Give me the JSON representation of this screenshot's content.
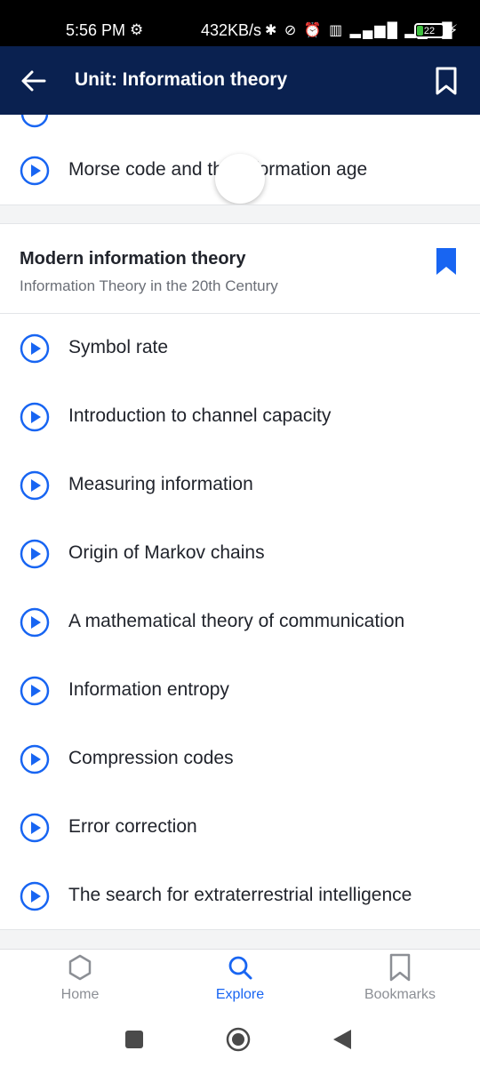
{
  "status_bar": {
    "time": "5:56 PM",
    "settings_glyph": "⚙",
    "network_speed": "432KB/s",
    "icons_text": "✱ ⊘ ⏰ ▥ ▂▄▆█ ▂▄▆█",
    "battery": "22",
    "battery_fraction": 0.22
  },
  "app_bar": {
    "title": "Unit: Information theory",
    "back_icon": "arrow-left-icon",
    "bookmark_icon": "bookmark-outline-icon"
  },
  "colors": {
    "app_bar_bg": "#0a2150",
    "accent": "#1865f2",
    "text": "#21242c",
    "muted": "#6b6f77"
  },
  "previous_section": {
    "last_lesson": "Morse code and the information age"
  },
  "section": {
    "title": "Modern information theory",
    "subtitle": "Information Theory in the 20th Century",
    "bookmarked": true,
    "lessons": [
      "Symbol rate",
      "Introduction to channel capacity",
      "Measuring information",
      "Origin of Markov chains",
      "A mathematical theory of communication",
      "Information entropy",
      "Compression codes",
      "Error correction",
      "The search for extraterrestrial intelligence"
    ]
  },
  "bottom_nav": {
    "home": "Home",
    "explore": "Explore",
    "bookmarks": "Bookmarks",
    "active": "explore"
  }
}
